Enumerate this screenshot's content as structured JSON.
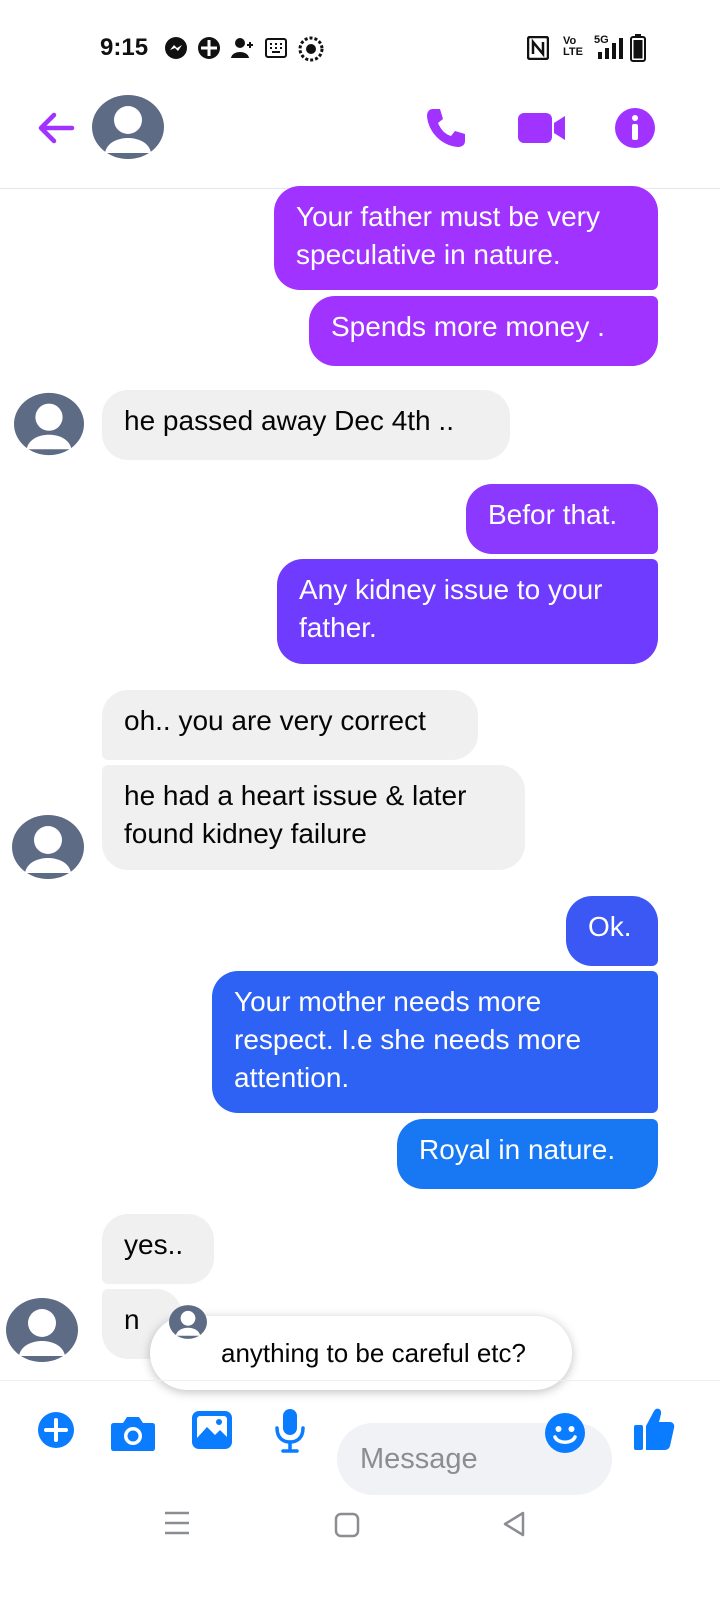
{
  "status_bar": {
    "time": "9:15",
    "left_icons": [
      "messenger-icon",
      "badge-icon",
      "person-add-icon",
      "keyboard-icon",
      "settings-badge-icon"
    ],
    "right_icons": [
      "nfc-icon",
      "volte-icon",
      "5g-signal-icon",
      "battery-icon"
    ],
    "volte_label": "Vo\nLTE",
    "network_label": "5G"
  },
  "header": {
    "back_icon": "back-arrow-icon",
    "actions": [
      "phone-icon",
      "video-icon",
      "info-icon"
    ]
  },
  "colors": {
    "accent": "#a033ff",
    "outgoing_purple": "#a033ff",
    "outgoing_violet": "#7b3aff",
    "outgoing_blue": "#2a62f2",
    "outgoing_blue_light": "#1877f2",
    "incoming_bg": "#f0f0f0",
    "composer_blue": "#0a7cff"
  },
  "messages": [
    {
      "side": "out",
      "text": "Your father must be very\nspeculative in nature."
    },
    {
      "side": "out",
      "text": "Spends more money ."
    },
    {
      "side": "in",
      "text": "he passed away Dec 4th .."
    },
    {
      "side": "out",
      "text": "Befor that."
    },
    {
      "side": "out",
      "text": "Any kidney issue to your\nfather."
    },
    {
      "side": "in",
      "text": "oh.. you are very correct"
    },
    {
      "side": "in",
      "text": "he had a heart issue & later\nfound kidney failure"
    },
    {
      "side": "out",
      "text": "Ok."
    },
    {
      "side": "out",
      "text": "Your mother needs more\nrespect. I.e she needs more\nattention."
    },
    {
      "side": "out",
      "text": "Royal in nature."
    },
    {
      "side": "in",
      "text": "yes.."
    },
    {
      "side": "in",
      "text": "n"
    }
  ],
  "typing_preview": {
    "text": "anything to be careful etc?"
  },
  "composer": {
    "placeholder": "Message",
    "icons": [
      "plus-icon",
      "camera-icon",
      "gallery-icon",
      "microphone-icon",
      "emoji-icon",
      "like-icon"
    ]
  },
  "nav_bar": {
    "icons": [
      "menu-icon",
      "home-icon",
      "back-icon"
    ]
  }
}
